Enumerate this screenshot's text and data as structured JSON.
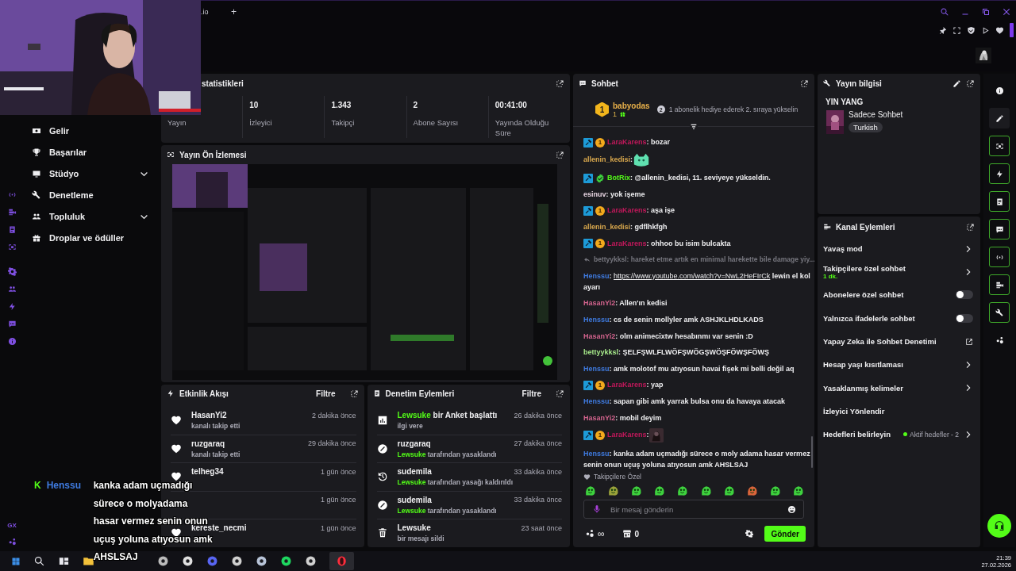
{
  "browser": {
    "tab": ".io",
    "new_tab": "+"
  },
  "sidebar": {
    "items": [
      {
        "label": "Gelir",
        "expandable": false
      },
      {
        "label": "Başarılar",
        "expandable": false
      },
      {
        "label": "Stüdyo",
        "expandable": true
      },
      {
        "label": "Denetleme",
        "expandable": false
      },
      {
        "label": "Topluluk",
        "expandable": true
      },
      {
        "label": "Droplar ve ödüller",
        "expandable": false
      }
    ],
    "footer": "GX"
  },
  "stats": {
    "title": "statistikleri",
    "cells": [
      {
        "label": "Yayın"
      },
      {
        "value": "10",
        "label": "İzleyici"
      },
      {
        "value": "1.343",
        "label": "Takipçi"
      },
      {
        "value": "2",
        "label": "Abone Sayısı"
      },
      {
        "value": "00:41:00",
        "label": "Yayında Olduğu Süre"
      }
    ]
  },
  "preview": {
    "title": "Yayın Ön İzlemesi",
    "kind": "picture"
  },
  "event_feed": {
    "title": "Etkinlik Akışı",
    "filter": "Filtre",
    "items": [
      {
        "name": "HasanYi2",
        "sub": "kanalı takip etti",
        "time": "2 dakika önce"
      },
      {
        "name": "ruzgaraq",
        "sub": "kanalı takip etti",
        "time": "29 dakika önce"
      },
      {
        "name": "telheg34",
        "time": "1 gün önce"
      },
      {
        "time": "1 gün önce"
      },
      {
        "name": "kereste_necmi",
        "time": "1 gün önce"
      }
    ]
  },
  "moderation": {
    "title": "Denetim Eylemleri",
    "filter": "Filtre",
    "items": [
      {
        "kind": "poll",
        "actor": "Lewsuke",
        "title": "bir Anket başlattı",
        "sub": "ilgi vere",
        "time": "26 dakika önce"
      },
      {
        "kind": "ban",
        "title": "ruzgaraq",
        "actor": "Lewsuke",
        "sub": "tarafından yasaklandı",
        "time": "27 dakika önce"
      },
      {
        "kind": "unban",
        "title": "sudemila",
        "actor": "Lewsuke",
        "sub": "tarafından yasağı kaldırıldı",
        "time": "33 dakika önce"
      },
      {
        "kind": "ban",
        "title": "sudemila",
        "actor": "Lewsuke",
        "sub": "tarafından yasaklandı",
        "time": "33 dakika önce"
      },
      {
        "kind": "delete",
        "title": "Lewsuke",
        "sub": "bir mesajı sildi",
        "time": "23 saat önce"
      }
    ]
  },
  "chat": {
    "title": "Sohbet",
    "pinned": {
      "badge": "1",
      "user": "babyodas",
      "gifts": "1",
      "rank": "2",
      "text": "1 abonelik hediye ederek 2. sıraya yükselin"
    },
    "messages": [
      {
        "kind": "message",
        "user": "LaraKarens",
        "color": "#c2185b",
        "badges": [
          {
            "kind": "mod"
          },
          {
            "kind": "sub",
            "text": "1"
          }
        ],
        "text": ": bozar"
      },
      {
        "kind": "cat_emote",
        "user": "allenin_kedisi",
        "color": "#d9a84e",
        "text": ":"
      },
      {
        "kind": "message",
        "user": "BotRix",
        "color": "#53fc18",
        "badges": [
          {
            "kind": "mod"
          },
          {
            "kind": "verified"
          }
        ],
        "text": ": @allenin_kedisi, 11. seviyeye yükseldin."
      },
      {
        "kind": "message",
        "user": "esinuv",
        "color": "#e6d3e0",
        "text": ": yok işeme"
      },
      {
        "kind": "message",
        "user": "LaraKarens",
        "color": "#c2185b",
        "badges": [
          {
            "kind": "mod"
          },
          {
            "kind": "sub",
            "text": "1"
          }
        ],
        "text": ": aşa işe"
      },
      {
        "kind": "message",
        "user": "allenin_kedisi",
        "color": "#d9a84e",
        "text": ": gdflhkfgh"
      },
      {
        "kind": "message",
        "user": "LaraKarens",
        "color": "#c2185b",
        "badges": [
          {
            "kind": "mod"
          },
          {
            "kind": "sub",
            "text": "1"
          }
        ],
        "text": ": ohhoo bu isim bulcakta"
      },
      {
        "kind": "reply",
        "text": "bettyykksl: hareket etme artık en minimal harekette bile damage yiy..."
      },
      {
        "kind": "message",
        "user": "Henssu",
        "color": "#3f7be0",
        "text": ":",
        "link": "https://www.youtube.com/watch?v=NwL2HeFIrCk",
        "after": "lewin el kol ayarı"
      },
      {
        "kind": "message",
        "user": "HasanYi2",
        "color": "#d4648e",
        "text": ": Allen'ın kedisi"
      },
      {
        "kind": "message",
        "user": "Henssu",
        "color": "#3f7be0",
        "text": ": cs de senin mollyler amk ASHJKLHDLKADS"
      },
      {
        "kind": "message",
        "user": "HasanYi2",
        "color": "#d4648e",
        "text": ": olm animecixtw hesabınmı var senin :D"
      },
      {
        "kind": "message",
        "user": "bettyykksl",
        "color": "#a6e88a",
        "text": ": ŞELFŞWLFLWÖFŞWÖGŞWÖŞFÖWŞFÖWŞ"
      },
      {
        "kind": "message",
        "user": "Henssu",
        "color": "#3f7be0",
        "text": ": amk molotof mu atıyosun havai fişek mi belli değil aq"
      },
      {
        "kind": "message",
        "user": "LaraKarens",
        "color": "#c2185b",
        "badges": [
          {
            "kind": "mod"
          },
          {
            "kind": "sub",
            "text": "1"
          }
        ],
        "text": ": yap"
      },
      {
        "kind": "message",
        "user": "Henssu",
        "color": "#3f7be0",
        "text": ": sapan gibi amk yarrak bulsa onu da havaya atacak"
      },
      {
        "kind": "message",
        "user": "HasanYi2",
        "color": "#d4648e",
        "text": ": mobil deyim"
      },
      {
        "kind": "image_emote",
        "user": "LaraKarens",
        "color": "#c2185b",
        "badges": [
          {
            "kind": "mod"
          },
          {
            "kind": "sub",
            "text": "1"
          }
        ],
        "text": ":"
      },
      {
        "kind": "message",
        "user": "Henssu",
        "color": "#3f7be0",
        "text": ": kanka adam uçmadığı sürece o moly adama hasar vermez senin onun uçuş yoluna atıyosun amk AHSLSAJ"
      }
    ],
    "emote_set": "Takipçilere Özel",
    "input": {
      "placeholder": "Bir mesaj gönderin"
    },
    "points": "∞",
    "store": "0",
    "send": "Gönder"
  },
  "stream_info": {
    "title": "Yayın bilgisi",
    "stream_title": "YIN YANG",
    "category": "Sadece Sohbet",
    "tag": "Turkish"
  },
  "channel_actions": {
    "title": "Kanal Eylemleri",
    "items": [
      {
        "kind": "chevron",
        "label": "Yavaş mod"
      },
      {
        "kind": "chevron",
        "label": "Takipçilere özel sohbet",
        "sub": "1 dk."
      },
      {
        "kind": "toggle",
        "label": "Abonelere özel sohbet",
        "on": false
      },
      {
        "kind": "toggle",
        "label": "Yalnızca ifadelerle sohbet",
        "on": false
      },
      {
        "kind": "external",
        "label": "Yapay Zeka ile Sohbet Denetimi"
      },
      {
        "kind": "chevron",
        "label": "Hesap yaşı kısıtlaması"
      },
      {
        "kind": "chevron",
        "label": "Yasaklanmış kelimeler"
      },
      {
        "kind": "plain",
        "label": "İzleyici Yönlendir"
      },
      {
        "kind": "goals",
        "label": "Hedefleri belirleyin",
        "status": "Aktif hedefler - 2"
      }
    ]
  },
  "rail": [
    {
      "active": false
    },
    {
      "active": false
    },
    {
      "active": true
    },
    {
      "active": true
    },
    {
      "active": true
    },
    {
      "active": true
    },
    {
      "active": true
    },
    {
      "active": true
    },
    {
      "active": true
    },
    {
      "active": false
    }
  ],
  "caption": {
    "badge": "K",
    "user": "Henssu",
    "lines": [
      "kanka adam uçmadığı",
      "sürece o molyadama",
      "hasar vermez senin onun",
      "uçuş yoluna atıyosun amk",
      "AHSLSAJ"
    ]
  },
  "taskbar": {
    "time": "21:39",
    "date": "27.02.2026"
  }
}
